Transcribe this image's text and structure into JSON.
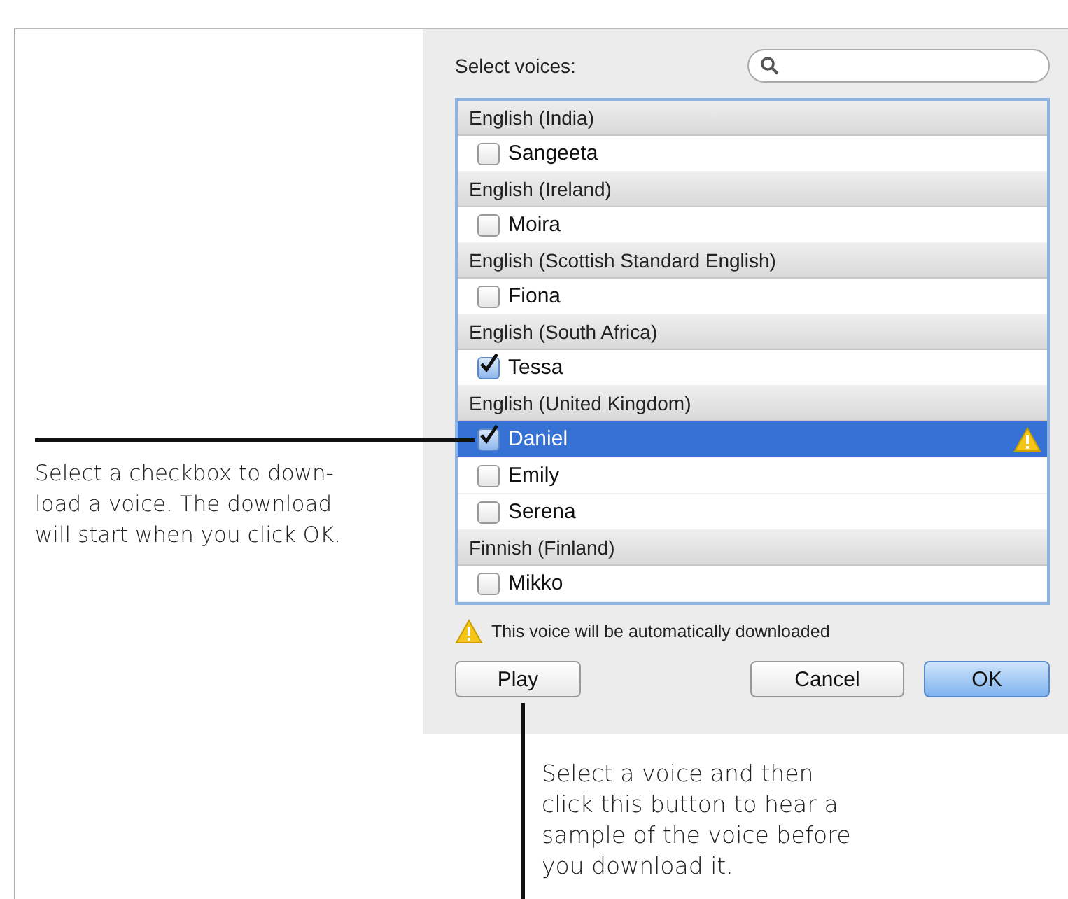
{
  "dialog": {
    "label": "Select voices:",
    "groups": [
      {
        "name": "English (India)",
        "voices": [
          {
            "name": "Sangeeta",
            "checked": false,
            "selected": false,
            "warning": false
          }
        ]
      },
      {
        "name": "English (Ireland)",
        "voices": [
          {
            "name": "Moira",
            "checked": false,
            "selected": false,
            "warning": false
          }
        ]
      },
      {
        "name": "English (Scottish Standard English)",
        "voices": [
          {
            "name": "Fiona",
            "checked": false,
            "selected": false,
            "warning": false
          }
        ]
      },
      {
        "name": "English (South Africa)",
        "voices": [
          {
            "name": "Tessa",
            "checked": true,
            "selected": false,
            "warning": false
          }
        ]
      },
      {
        "name": "English (United Kingdom)",
        "voices": [
          {
            "name": "Daniel",
            "checked": true,
            "selected": true,
            "warning": true
          },
          {
            "name": "Emily",
            "checked": false,
            "selected": false,
            "warning": false
          },
          {
            "name": "Serena",
            "checked": false,
            "selected": false,
            "warning": false
          }
        ]
      },
      {
        "name": "Finnish (Finland)",
        "voices": [
          {
            "name": "Mikko",
            "checked": false,
            "selected": false,
            "warning": false
          }
        ]
      }
    ],
    "notice": "This voice will be automatically downloaded",
    "buttons": [
      {
        "label": "Play",
        "default": false
      },
      {
        "label": "Cancel",
        "default": false
      },
      {
        "label": "OK",
        "default": true
      }
    ]
  },
  "callouts": [
    "Select a checkbox to down-\nload a voice. The download\nwill start when you click OK.",
    "Select a voice and then\nclick this button to hear a\nsample of the voice before\nyou download it."
  ]
}
